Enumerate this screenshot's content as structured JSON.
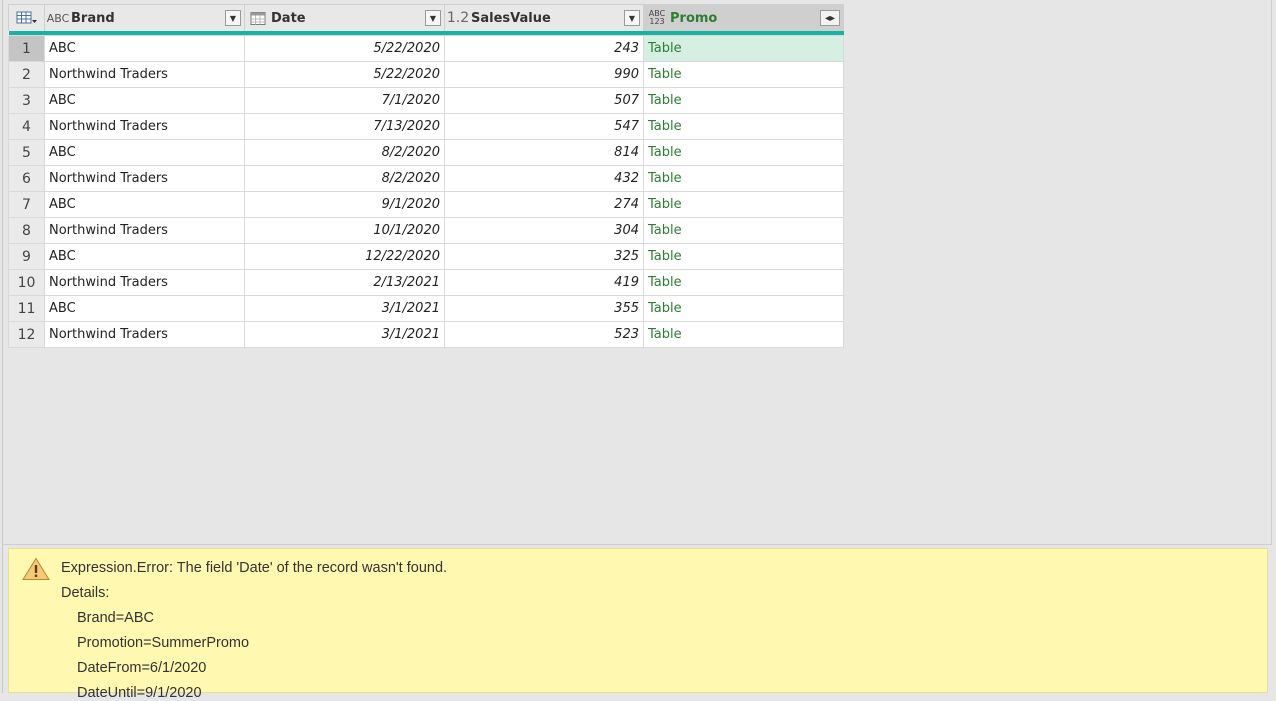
{
  "columns": [
    {
      "name": "Brand",
      "type_icon": "text-type-icon",
      "type_glyph": "ABC"
    },
    {
      "name": "Date",
      "type_icon": "date-type-icon"
    },
    {
      "name": "SalesValue",
      "type_icon": "decimal-type-icon",
      "type_glyph": "1.2"
    },
    {
      "name": "Promo",
      "type_icon": "any-type-icon",
      "type_glyph_top": "ABC",
      "type_glyph_bottom": "123"
    }
  ],
  "rows": [
    {
      "n": "1",
      "brand": "ABC",
      "date": "5/22/2020",
      "sales": "243",
      "promo": "Table"
    },
    {
      "n": "2",
      "brand": "Northwind Traders",
      "date": "5/22/2020",
      "sales": "990",
      "promo": "Table"
    },
    {
      "n": "3",
      "brand": "ABC",
      "date": "7/1/2020",
      "sales": "507",
      "promo": "Table"
    },
    {
      "n": "4",
      "brand": "Northwind Traders",
      "date": "7/13/2020",
      "sales": "547",
      "promo": "Table"
    },
    {
      "n": "5",
      "brand": "ABC",
      "date": "8/2/2020",
      "sales": "814",
      "promo": "Table"
    },
    {
      "n": "6",
      "brand": "Northwind Traders",
      "date": "8/2/2020",
      "sales": "432",
      "promo": "Table"
    },
    {
      "n": "7",
      "brand": "ABC",
      "date": "9/1/2020",
      "sales": "274",
      "promo": "Table"
    },
    {
      "n": "8",
      "brand": "Northwind Traders",
      "date": "10/1/2020",
      "sales": "304",
      "promo": "Table"
    },
    {
      "n": "9",
      "brand": "ABC",
      "date": "12/22/2020",
      "sales": "325",
      "promo": "Table"
    },
    {
      "n": "10",
      "brand": "Northwind Traders",
      "date": "2/13/2021",
      "sales": "419",
      "promo": "Table"
    },
    {
      "n": "11",
      "brand": "ABC",
      "date": "3/1/2021",
      "sales": "355",
      "promo": "Table"
    },
    {
      "n": "12",
      "brand": "Northwind Traders",
      "date": "3/1/2021",
      "sales": "523",
      "promo": "Table"
    }
  ],
  "selected_row": "1",
  "error": {
    "icon": "warning-icon",
    "message": "Expression.Error: The field 'Date' of the record wasn't found.",
    "details_label": "Details:",
    "details": [
      "Brand=ABC",
      "Promotion=SummerPromo",
      "DateFrom=6/1/2020",
      "DateUntil=9/1/2020"
    ]
  },
  "colors": {
    "accent": "#16b3a2",
    "promo_text": "#2e7d32",
    "error_bg": "#fff8b0"
  }
}
